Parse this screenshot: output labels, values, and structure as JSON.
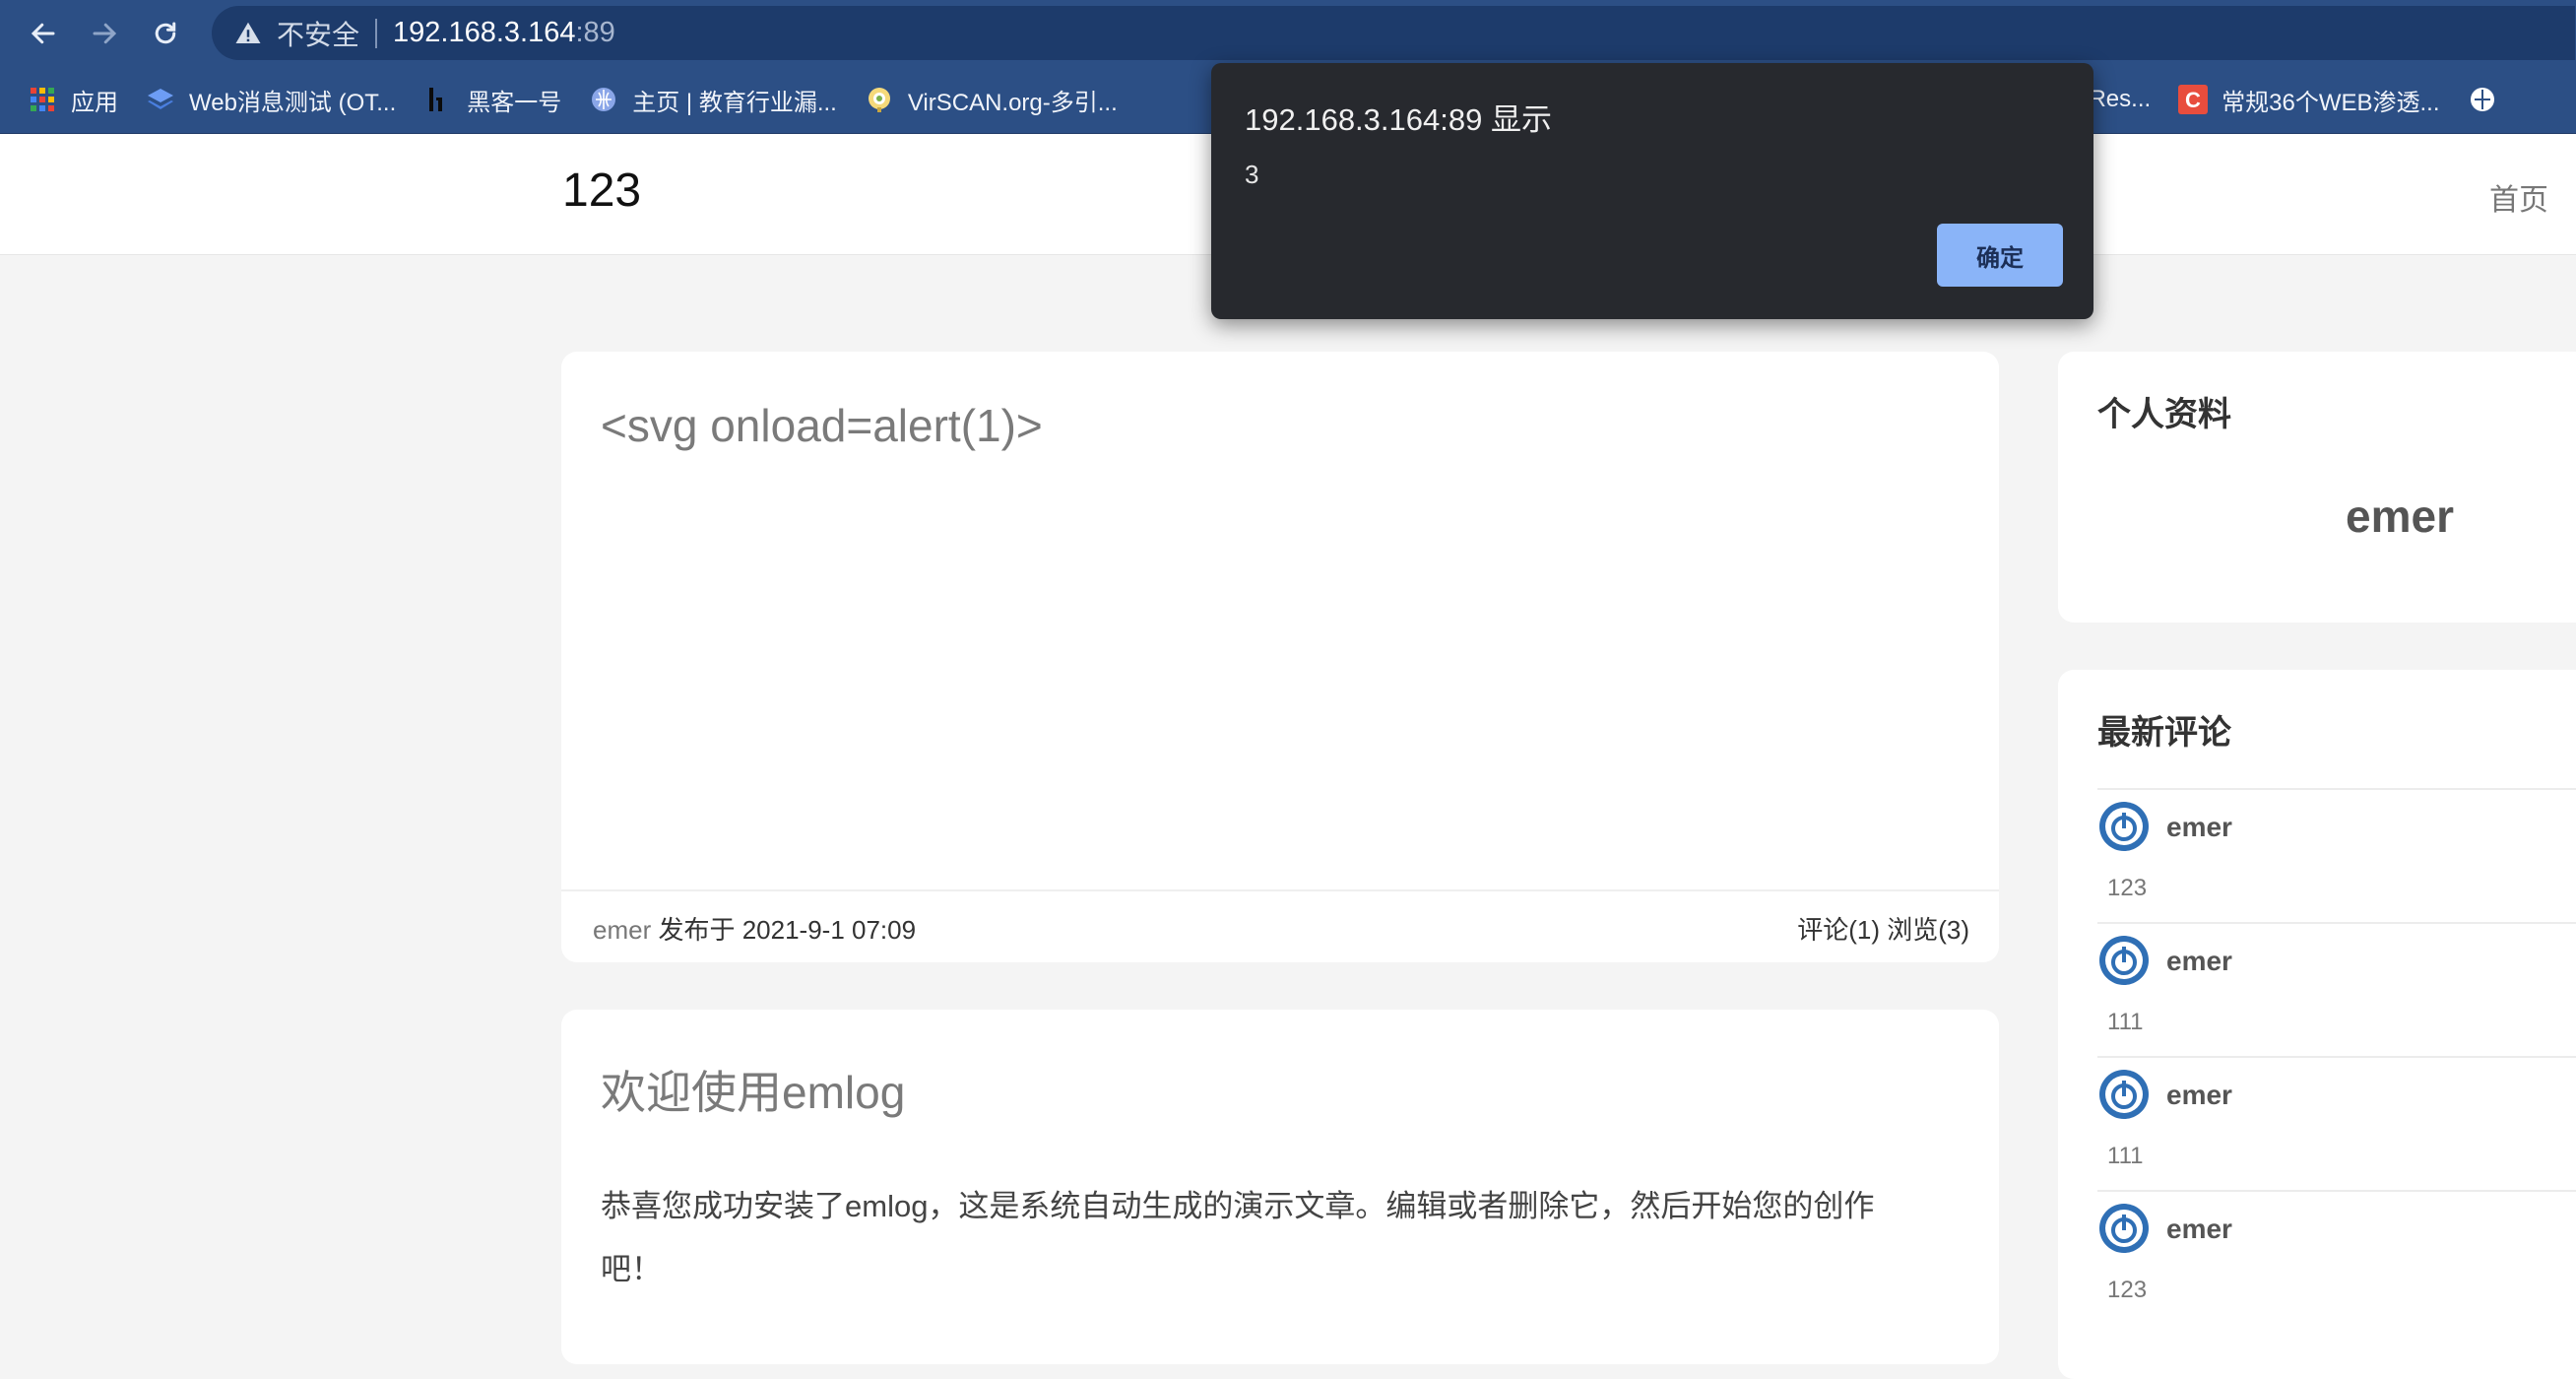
{
  "browser": {
    "security_label": "不安全",
    "url_host": "192.168.3.164",
    "url_port": ":89",
    "bookmarks": [
      {
        "label": "应用",
        "icon": "apps-grid-icon"
      },
      {
        "label": "Web消息测试 (OT...",
        "icon": "layers-icon"
      },
      {
        "label": "黑客一号",
        "icon": "h1-logo-icon"
      },
      {
        "label": "主页 | 教育行业漏...",
        "icon": "globe-icon"
      },
      {
        "label": "VirSCAN.org-多引...",
        "icon": "virscan-icon"
      },
      {
        "label": "earch Res...",
        "icon": "bookmark-icon"
      },
      {
        "label": "常规36个WEB渗透...",
        "icon": "csdn-c-icon"
      }
    ],
    "accent": "#2c4f85"
  },
  "site": {
    "title": "123",
    "nav_home": "首页"
  },
  "posts": [
    {
      "title": "<svg onload=alert(1)>",
      "author": "emer",
      "published": "发布于 2021-9-1 07:09",
      "stats": "评论(1)  浏览(3)"
    },
    {
      "title": "欢迎使用emlog",
      "body": "恭喜您成功安装了emlog，这是系统自动生成的演示文章。编辑或者删除它，然后开始您的创作吧！"
    }
  ],
  "sidebar": {
    "profile_title": "个人资料",
    "profile_name": "emer",
    "comments_title": "最新评论",
    "comments": [
      {
        "name": "emer",
        "text": "123"
      },
      {
        "name": "emer",
        "text": "111"
      },
      {
        "name": "emer",
        "text": "111"
      },
      {
        "name": "emer",
        "text": "123"
      }
    ]
  },
  "dialog": {
    "title": "192.168.3.164:89 显示",
    "message": "3",
    "ok_label": "确定",
    "button_color": "#8ab4f8"
  }
}
